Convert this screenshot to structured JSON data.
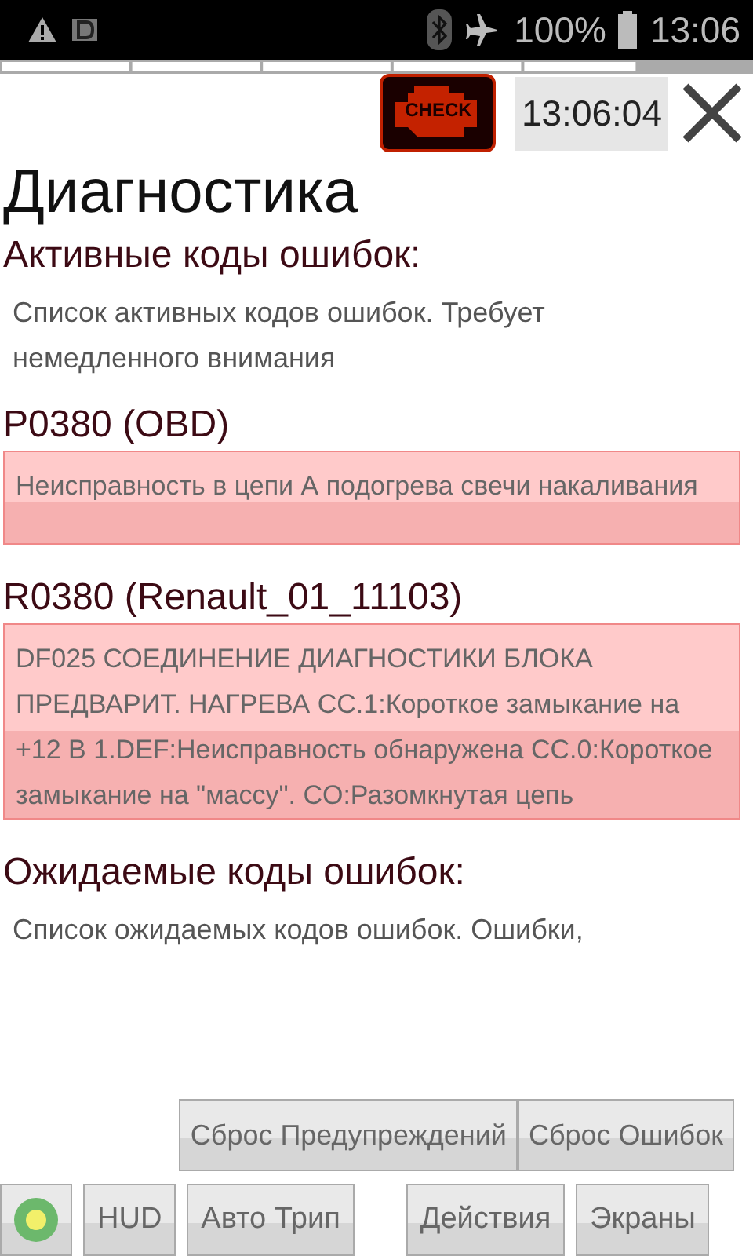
{
  "status_bar": {
    "battery": "100%",
    "time": "13:06"
  },
  "header": {
    "check_label": "CHECK",
    "clock": "13:06:04"
  },
  "title": "Диагностика",
  "sections": [
    {
      "heading": "Активные коды ошибок:",
      "description": "Список активных кодов ошибок. Требует немедленного внимания",
      "codes": [
        {
          "code": "P0380 (OBD)",
          "message": "Неисправность в цепи А подогрева свечи накаливания"
        },
        {
          "code": "R0380 (Renault_01_11103)",
          "message": "DF025 СОЕДИНЕНИЕ ДИАГНОСТИКИ БЛОКА ПРЕДВАРИТ. НАГРЕВА CC.1:Короткое замыкание на +12 В 1.DEF:Неисправность обнаружена CC.0:Короткое замыкание на \"массу\". CO:Разомкнутая цепь"
        }
      ]
    },
    {
      "heading": "Ожидаемые коды ошибок:",
      "description": "Список ожидаемых кодов ошибок. Ошибки,"
    }
  ],
  "reset_buttons": [
    "Сброс Предупреждений",
    "Сброс Ошибок"
  ],
  "bottom_buttons": [
    "HUD",
    "Авто Трип",
    "Действия",
    "Экраны"
  ]
}
